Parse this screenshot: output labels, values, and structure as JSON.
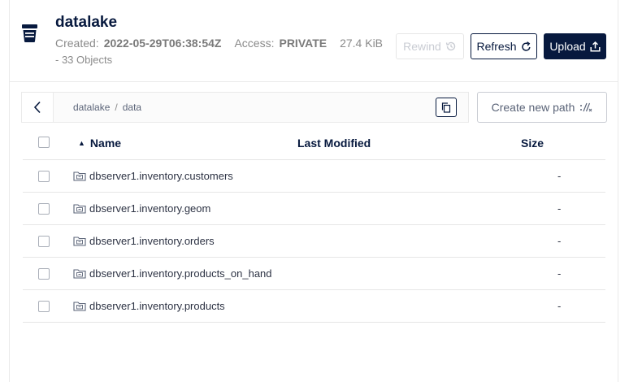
{
  "bucket": {
    "name": "datalake",
    "created_label": "Created:",
    "created_value": "2022-05-29T06:38:54Z",
    "access_label": "Access:",
    "access_value": "PRIVATE",
    "size": "27.4 KiB",
    "objects": "- 33 Objects",
    "icon": "bucket-icon"
  },
  "toolbar": {
    "rewind_label": "Rewind",
    "refresh_label": "Refresh",
    "upload_label": "Upload"
  },
  "breadcrumb": {
    "parts": [
      "datalake",
      "data"
    ],
    "separator": "/",
    "create_path_label": "Create new path"
  },
  "table": {
    "columns": [
      "Name",
      "Last Modified",
      "Size"
    ],
    "sort_indicator": "▲",
    "rows": [
      {
        "name": "dbserver1.inventory.customers",
        "modified": "",
        "size": "-"
      },
      {
        "name": "dbserver1.inventory.geom",
        "modified": "",
        "size": "-"
      },
      {
        "name": "dbserver1.inventory.orders",
        "modified": "",
        "size": "-"
      },
      {
        "name": "dbserver1.inventory.products_on_hand",
        "modified": "",
        "size": "-"
      },
      {
        "name": "dbserver1.inventory.products",
        "modified": "",
        "size": "-"
      }
    ]
  },
  "colors": {
    "primary": "#07193e",
    "border": "#eaeaea",
    "muted": "#8a8a8a"
  }
}
